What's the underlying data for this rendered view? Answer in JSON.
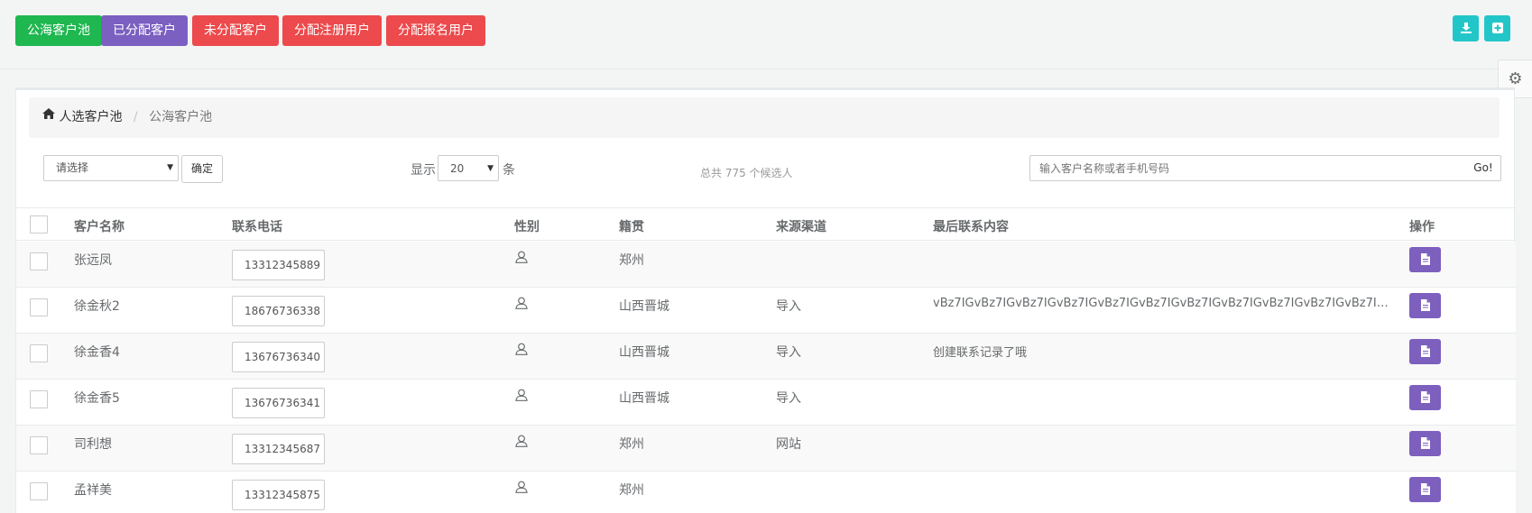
{
  "topbar": {
    "buttons": [
      {
        "label": "公海客户池",
        "color": "#1fb750"
      },
      {
        "label": "已分配客户",
        "color": "#7b5fc1"
      },
      {
        "label": "未分配客户",
        "color": "#ec4a4c"
      },
      {
        "label": "分配注册用户",
        "color": "#ec4a4c"
      },
      {
        "label": "分配报名用户",
        "color": "#ec4a4c"
      }
    ],
    "icon_buttons": [
      "download-icon",
      "add-icon"
    ]
  },
  "settings": {
    "icon": "gear-icon"
  },
  "breadcrumb": {
    "home": "人选客户池",
    "separator": "/",
    "current": "公海客户池"
  },
  "filters": {
    "select_value": "请选择",
    "confirm_label": "确定",
    "show_label": "显示",
    "page_size": "20",
    "unit_label": "条",
    "total_text": "总共 775 个候选人",
    "search_placeholder": "输入客户名称或者手机号码",
    "go_label": "Go!"
  },
  "table": {
    "headers": {
      "name": "客户名称",
      "phone": "联系电话",
      "gender": "性别",
      "origin": "籍贯",
      "source": "来源渠道",
      "last": "最后联系内容",
      "action": "操作"
    },
    "rows": [
      {
        "name": "张远凤",
        "phone": "13312345889",
        "origin": "郑州",
        "source": "",
        "last": ""
      },
      {
        "name": "徐金秋2",
        "phone": "18676736338",
        "origin": "山西晋城",
        "source": "导入",
        "last": "vBz7IGvBz7IGvBz7IGvBz7IGvBz7IGvBz7IGvBz7IGvBz7IGvBz7IGvBz7IGvBz7IGv..."
      },
      {
        "name": "徐金香4",
        "phone": "13676736340",
        "origin": "山西晋城",
        "source": "导入",
        "last": "创建联系记录了哦"
      },
      {
        "name": "徐金香5",
        "phone": "13676736341",
        "origin": "山西晋城",
        "source": "导入",
        "last": ""
      },
      {
        "name": "司利想",
        "phone": "13312345687",
        "origin": "郑州",
        "source": "网站",
        "last": ""
      },
      {
        "name": "孟祥美",
        "phone": "13312345875",
        "origin": "郑州",
        "source": "",
        "last": ""
      }
    ]
  },
  "colors": {
    "green": "#1fb750",
    "purple": "#7b5fc1",
    "red": "#ec4a4c",
    "cyan": "#23c6c8",
    "action_purple": "#7d5fbe"
  }
}
